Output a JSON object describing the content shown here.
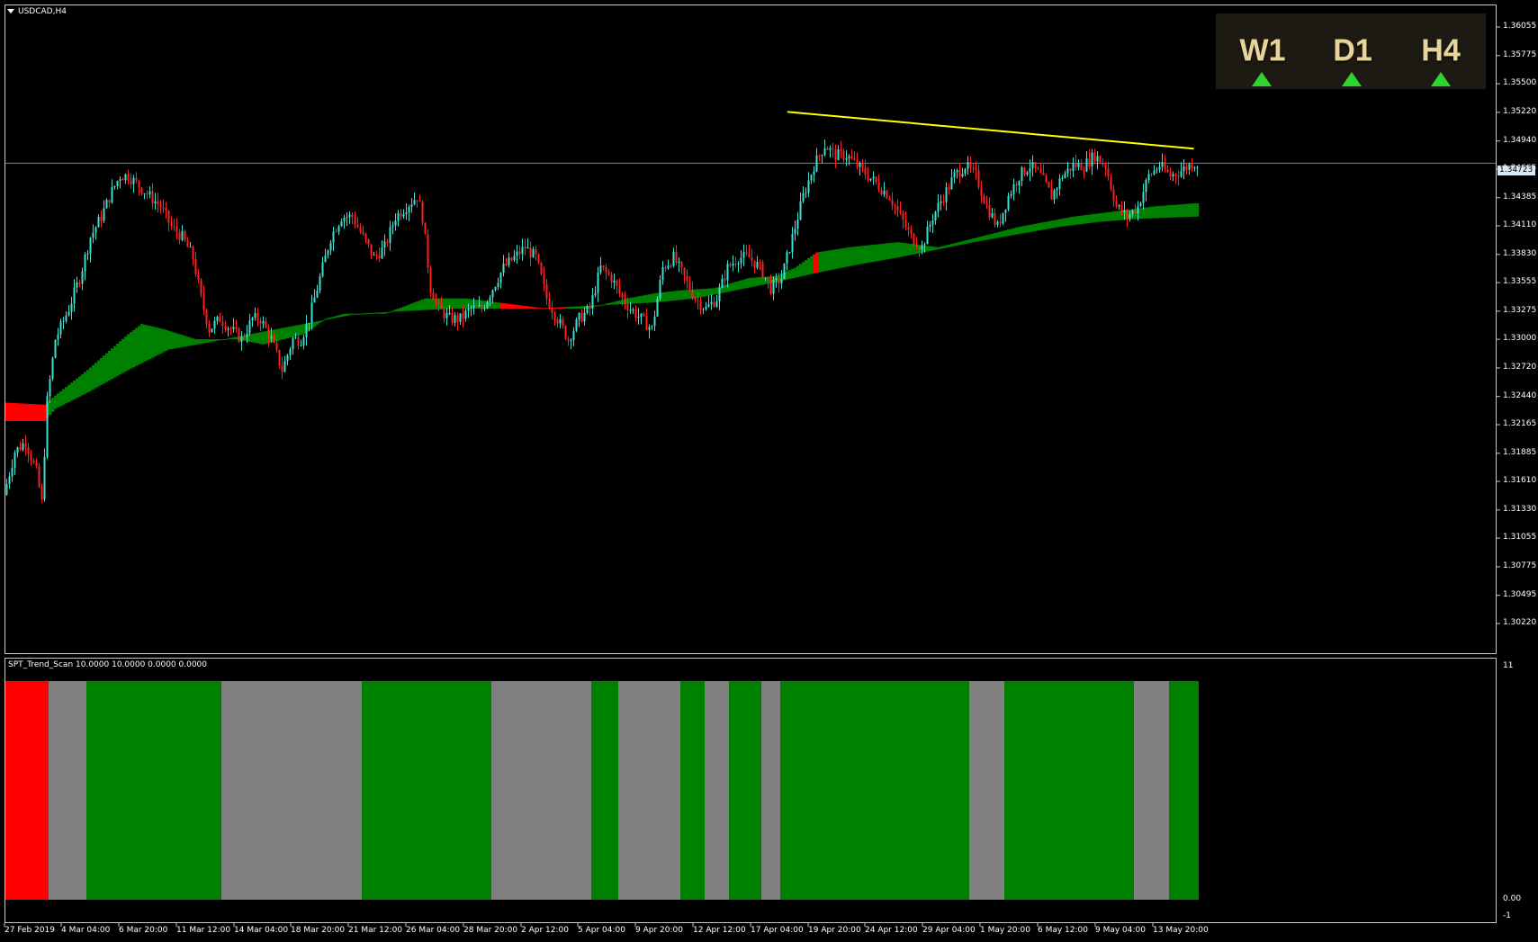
{
  "chart_header": {
    "symbol": "USDCAD,H4"
  },
  "indicator_header": {
    "label": "SPT_Trend_Scan 10.0000 10.0000 0.0000 0.0000"
  },
  "price_axis": [
    "1.36055",
    "1.35775",
    "1.35500",
    "1.35220",
    "1.34940",
    "1.34665",
    "1.34385",
    "1.34110",
    "1.33830",
    "1.33555",
    "1.33275",
    "1.33000",
    "1.32720",
    "1.32440",
    "1.32165",
    "1.31885",
    "1.31610",
    "1.31330",
    "1.31055",
    "1.30775",
    "1.30495",
    "1.30220"
  ],
  "current_price": "1.34723",
  "indicator_axis": [
    "11",
    "0.00",
    "-1"
  ],
  "time_axis": [
    "27 Feb 2019",
    "4 Mar 04:00",
    "6 Mar 20:00",
    "11 Mar 12:00",
    "14 Mar 04:00",
    "18 Mar 20:00",
    "21 Mar 12:00",
    "26 Mar 04:00",
    "28 Mar 20:00",
    "2 Apr 12:00",
    "5 Apr 04:00",
    "9 Apr 20:00",
    "12 Apr 12:00",
    "17 Apr 04:00",
    "19 Apr 20:00",
    "24 Apr 12:00",
    "29 Apr 04:00",
    "1 May 20:00",
    "6 May 12:00",
    "9 May 04:00",
    "13 May 20:00"
  ],
  "timeframes": [
    {
      "name": "W1",
      "direction": "up"
    },
    {
      "name": "D1",
      "direction": "up"
    },
    {
      "name": "H4",
      "direction": "up"
    }
  ],
  "colors": {
    "bull_candle": "#40e0d0",
    "bear_candle": "#ff2020",
    "band_up": "#008000",
    "band_down": "#ff0000",
    "trend_line": "#ffff00",
    "scan_up": "#008000",
    "scan_flat": "#808080",
    "scan_down": "#ff0000",
    "tf_arrow": "#2fd42f"
  },
  "chart_data": {
    "type": "candlestick",
    "symbol": "USDCAD",
    "timeframe": "H4",
    "ylim": [
      1.3022,
      1.362
    ],
    "current_price": 1.34723,
    "close_path": [
      [
        0,
        1.3148
      ],
      [
        4,
        1.319
      ],
      [
        8,
        1.32
      ],
      [
        12,
        1.317
      ],
      [
        14,
        1.314
      ],
      [
        16,
        1.324
      ],
      [
        19,
        1.33
      ],
      [
        24,
        1.333
      ],
      [
        28,
        1.336
      ],
      [
        32,
        1.34
      ],
      [
        36,
        1.342
      ],
      [
        40,
        1.3445
      ],
      [
        43,
        1.346
      ],
      [
        46,
        1.346
      ],
      [
        50,
        1.345
      ],
      [
        54,
        1.344
      ],
      [
        58,
        1.343
      ],
      [
        62,
        1.341
      ],
      [
        66,
        1.34
      ],
      [
        70,
        1.338
      ],
      [
        73,
        1.334
      ],
      [
        76,
        1.331
      ],
      [
        80,
        1.332
      ],
      [
        84,
        1.331
      ],
      [
        88,
        1.33
      ],
      [
        92,
        1.332
      ],
      [
        95,
        1.332
      ],
      [
        99,
        1.33
      ],
      [
        103,
        1.327
      ],
      [
        107,
        1.33
      ],
      [
        110,
        1.33
      ],
      [
        113,
        1.332
      ],
      [
        117,
        1.336
      ],
      [
        121,
        1.34
      ],
      [
        125,
        1.342
      ],
      [
        129,
        1.342
      ],
      [
        133,
        1.34
      ],
      [
        137,
        1.338
      ],
      [
        141,
        1.339
      ],
      [
        145,
        1.342
      ],
      [
        149,
        1.343
      ],
      [
        153,
        1.344
      ],
      [
        155,
        1.342
      ],
      [
        158,
        1.335
      ],
      [
        161,
        1.333
      ],
      [
        165,
        1.332
      ],
      [
        169,
        1.332
      ],
      [
        173,
        1.333
      ],
      [
        177,
        1.333
      ],
      [
        181,
        1.335
      ],
      [
        185,
        1.337
      ],
      [
        189,
        1.338
      ],
      [
        193,
        1.339
      ],
      [
        197,
        1.338
      ],
      [
        201,
        1.334
      ],
      [
        205,
        1.332
      ],
      [
        209,
        1.33
      ],
      [
        213,
        1.332
      ],
      [
        217,
        1.333
      ],
      [
        221,
        1.337
      ],
      [
        225,
        1.336
      ],
      [
        229,
        1.334
      ],
      [
        232,
        1.333
      ],
      [
        236,
        1.332
      ],
      [
        240,
        1.331
      ],
      [
        244,
        1.337
      ],
      [
        248,
        1.338
      ],
      [
        252,
        1.336
      ],
      [
        256,
        1.334
      ],
      [
        260,
        1.333
      ],
      [
        264,
        1.334
      ],
      [
        268,
        1.337
      ],
      [
        272,
        1.338
      ],
      [
        276,
        1.338
      ],
      [
        280,
        1.337
      ],
      [
        284,
        1.335
      ],
      [
        288,
        1.336
      ],
      [
        292,
        1.34
      ],
      [
        296,
        1.344
      ],
      [
        300,
        1.347
      ],
      [
        304,
        1.349
      ],
      [
        308,
        1.348
      ],
      [
        312,
        1.348
      ],
      [
        316,
        1.347
      ],
      [
        320,
        1.346
      ],
      [
        324,
        1.345
      ],
      [
        328,
        1.344
      ],
      [
        332,
        1.342
      ],
      [
        336,
        1.34
      ],
      [
        340,
        1.339
      ],
      [
        344,
        1.342
      ],
      [
        348,
        1.344
      ],
      [
        352,
        1.346
      ],
      [
        356,
        1.347
      ],
      [
        360,
        1.346
      ],
      [
        364,
        1.343
      ],
      [
        368,
        1.341
      ],
      [
        372,
        1.344
      ],
      [
        376,
        1.346
      ],
      [
        380,
        1.347
      ],
      [
        384,
        1.346
      ],
      [
        388,
        1.344
      ],
      [
        392,
        1.346
      ],
      [
        396,
        1.347
      ],
      [
        400,
        1.347
      ],
      [
        404,
        1.348
      ],
      [
        408,
        1.347
      ],
      [
        412,
        1.343
      ],
      [
        416,
        1.342
      ],
      [
        420,
        1.343
      ],
      [
        424,
        1.346
      ],
      [
        428,
        1.347
      ],
      [
        432,
        1.346
      ],
      [
        436,
        1.3465
      ],
      [
        440,
        1.3472
      ]
    ],
    "ma_band": {
      "upper": [
        [
          0,
          1.3238
        ],
        [
          14,
          1.3236
        ],
        [
          18,
          1.3245
        ],
        [
          30,
          1.327
        ],
        [
          45,
          1.3305
        ],
        [
          50,
          1.3315
        ],
        [
          58,
          1.331
        ],
        [
          70,
          1.33
        ],
        [
          85,
          1.33
        ],
        [
          95,
          1.3295
        ],
        [
          110,
          1.3305
        ],
        [
          118,
          1.332
        ],
        [
          125,
          1.3325
        ],
        [
          140,
          1.3325
        ],
        [
          155,
          1.334
        ],
        [
          170,
          1.334
        ],
        [
          185,
          1.3335
        ],
        [
          200,
          1.333
        ],
        [
          215,
          1.333
        ],
        [
          230,
          1.334
        ],
        [
          240,
          1.3345
        ],
        [
          250,
          1.3348
        ],
        [
          262,
          1.335
        ],
        [
          275,
          1.336
        ],
        [
          285,
          1.3362
        ],
        [
          292,
          1.337
        ],
        [
          300,
          1.3385
        ],
        [
          312,
          1.339
        ],
        [
          330,
          1.3395
        ],
        [
          345,
          1.339
        ],
        [
          360,
          1.34
        ],
        [
          375,
          1.341
        ],
        [
          395,
          1.342
        ],
        [
          410,
          1.3425
        ],
        [
          425,
          1.343
        ],
        [
          440,
          1.3433
        ]
      ],
      "lower": [
        [
          0,
          1.322
        ],
        [
          14,
          1.322
        ],
        [
          18,
          1.3232
        ],
        [
          30,
          1.3248
        ],
        [
          45,
          1.327
        ],
        [
          60,
          1.329
        ],
        [
          75,
          1.3297
        ],
        [
          90,
          1.3305
        ],
        [
          110,
          1.3315
        ],
        [
          130,
          1.3325
        ],
        [
          150,
          1.3328
        ],
        [
          165,
          1.333
        ],
        [
          180,
          1.333
        ],
        [
          195,
          1.333
        ],
        [
          210,
          1.3332
        ],
        [
          225,
          1.3334
        ],
        [
          240,
          1.3336
        ],
        [
          255,
          1.334
        ],
        [
          270,
          1.3348
        ],
        [
          285,
          1.3356
        ],
        [
          300,
          1.3365
        ],
        [
          315,
          1.3373
        ],
        [
          330,
          1.338
        ],
        [
          345,
          1.3388
        ],
        [
          360,
          1.3396
        ],
        [
          375,
          1.3403
        ],
        [
          390,
          1.341
        ],
        [
          405,
          1.3415
        ],
        [
          420,
          1.3418
        ],
        [
          440,
          1.342
        ]
      ],
      "red_segments": [
        [
          0,
          16
        ],
        [
          183,
          207
        ],
        [
          299,
          301
        ]
      ]
    },
    "trend_line": {
      "x1": 289.6,
      "y1": 1.35225,
      "x2": 440.2,
      "y2": 1.34865
    },
    "trend_scan": [
      {
        "from": 0,
        "to": 16,
        "state": "down"
      },
      {
        "from": 16,
        "to": 30,
        "state": "flat"
      },
      {
        "from": 30,
        "to": 80,
        "state": "up"
      },
      {
        "from": 80,
        "to": 132,
        "state": "flat"
      },
      {
        "from": 132,
        "to": 180,
        "state": "up"
      },
      {
        "from": 180,
        "to": 217,
        "state": "flat"
      },
      {
        "from": 217,
        "to": 227,
        "state": "up"
      },
      {
        "from": 227,
        "to": 250,
        "state": "flat"
      },
      {
        "from": 250,
        "to": 259,
        "state": "up"
      },
      {
        "from": 259,
        "to": 268,
        "state": "flat"
      },
      {
        "from": 268,
        "to": 280,
        "state": "up"
      },
      {
        "from": 280,
        "to": 287,
        "state": "flat"
      },
      {
        "from": 287,
        "to": 357,
        "state": "up"
      },
      {
        "from": 357,
        "to": 370,
        "state": "flat"
      },
      {
        "from": 370,
        "to": 418,
        "state": "up"
      },
      {
        "from": 418,
        "to": 431,
        "state": "flat"
      },
      {
        "from": 431,
        "to": 442,
        "state": "up"
      }
    ],
    "bars_visible": 442
  }
}
